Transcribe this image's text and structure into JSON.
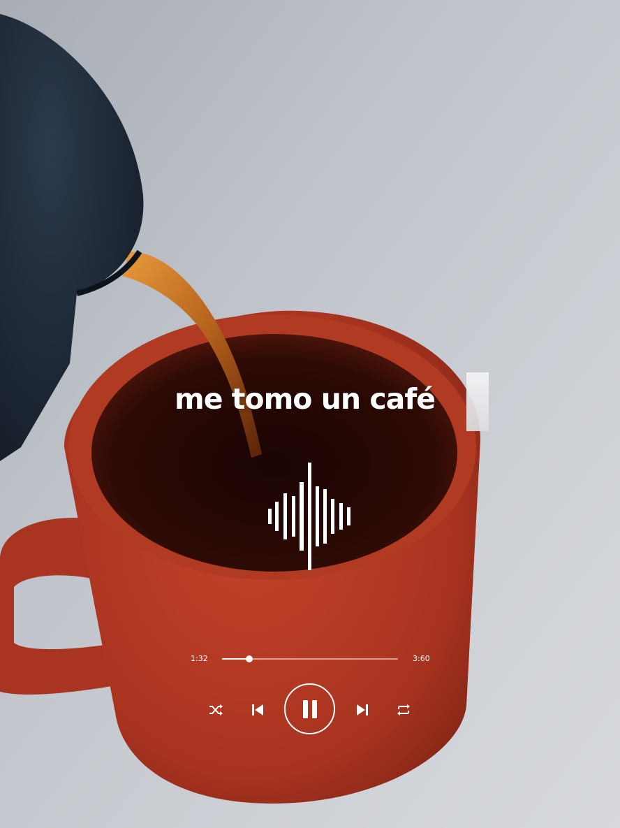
{
  "lyric": {
    "text": "me tomo un café"
  },
  "player": {
    "current_time": "1:32",
    "total_time": "3:60",
    "progress": 0.155,
    "controls": {
      "shuffle_icon": "shuffle-icon",
      "previous_icon": "skip-previous-icon",
      "pause_icon": "pause-icon",
      "next_icon": "skip-next-icon",
      "repeat_icon": "repeat-icon"
    }
  },
  "colors": {
    "mug": "#b83a22",
    "coffee": "#2a0b06",
    "kettle": "#1f2a38",
    "background": "#c9ccd1",
    "ui_white": "#ffffff"
  }
}
